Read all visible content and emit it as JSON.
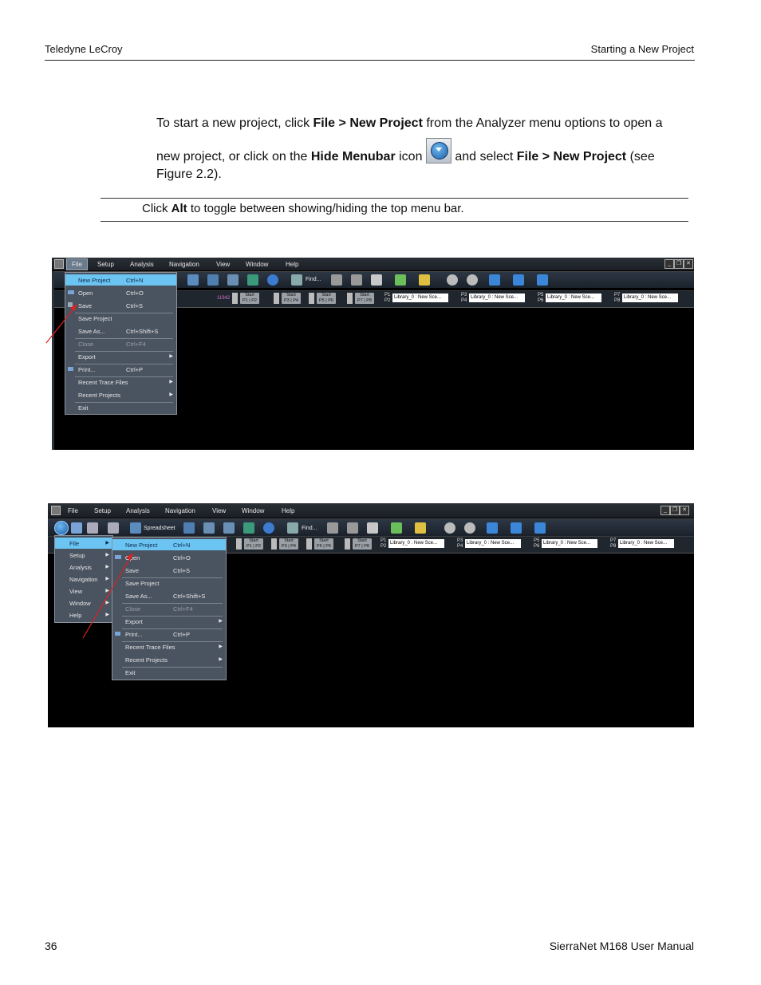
{
  "header": {
    "left": "Teledyne LeCroy",
    "right": "Starting a New Project"
  },
  "body": {
    "p1": "To start a new project, click ",
    "p1_b1": "File > New Project",
    "p1_2": " from the Analyzer menu options to open a",
    "p2": "new project, or click on the ",
    "p2_b1": "Hide Menubar",
    "p2_2": " icon ",
    "p2_3": " and select ",
    "p2_b2": "File > New Project",
    "p2_4": " (see",
    "p3": "Figure 2.2).",
    "note_1": "Click ",
    "note_b": "Alt",
    "note_2": " to toggle between showing/hiding the top menu bar."
  },
  "app_menus": [
    "File",
    "Setup",
    "Analysis",
    "Navigation",
    "View",
    "Window",
    "Help"
  ],
  "file_menu": [
    {
      "label": "New Project",
      "shortcut": "Ctrl+N"
    },
    {
      "label": "Open",
      "shortcut": "Ctrl+O"
    },
    {
      "label": "Save",
      "shortcut": "Ctrl+S"
    },
    {
      "label": "Save Project",
      "shortcut": ""
    },
    {
      "label": "Save As...",
      "shortcut": "Ctrl+Shift+S"
    },
    {
      "label": "Close",
      "shortcut": "Ctrl+F4"
    },
    {
      "label": "Export",
      "shortcut": ""
    },
    {
      "label": "Print...",
      "shortcut": "Ctrl+P"
    },
    {
      "label": "Recent Trace Files",
      "shortcut": ""
    },
    {
      "label": "Recent Projects",
      "shortcut": ""
    },
    {
      "label": "Exit",
      "shortcut": ""
    }
  ],
  "toolbar": {
    "spreadsheet": "Spreadsheet",
    "find": "Find...",
    "counter": "11942",
    "start": "Start",
    "port_pairs": [
      "P1 | P2",
      "P3 | P4",
      "P5 | P6",
      "P7 | P8"
    ],
    "port_labels": [
      "P1 P2",
      "P3 P4",
      "P5 P6",
      "P7 P8"
    ],
    "library": "Library_0 : New Sce..."
  },
  "window_buttons": [
    "_",
    "❐",
    "✕"
  ],
  "footer": {
    "left": "36",
    "right": "SierraNet M168 User Manual"
  },
  "colors": {
    "highlight": "#6cc4f2",
    "menu_bg": "#4a5360",
    "arrow": "#e02020"
  }
}
